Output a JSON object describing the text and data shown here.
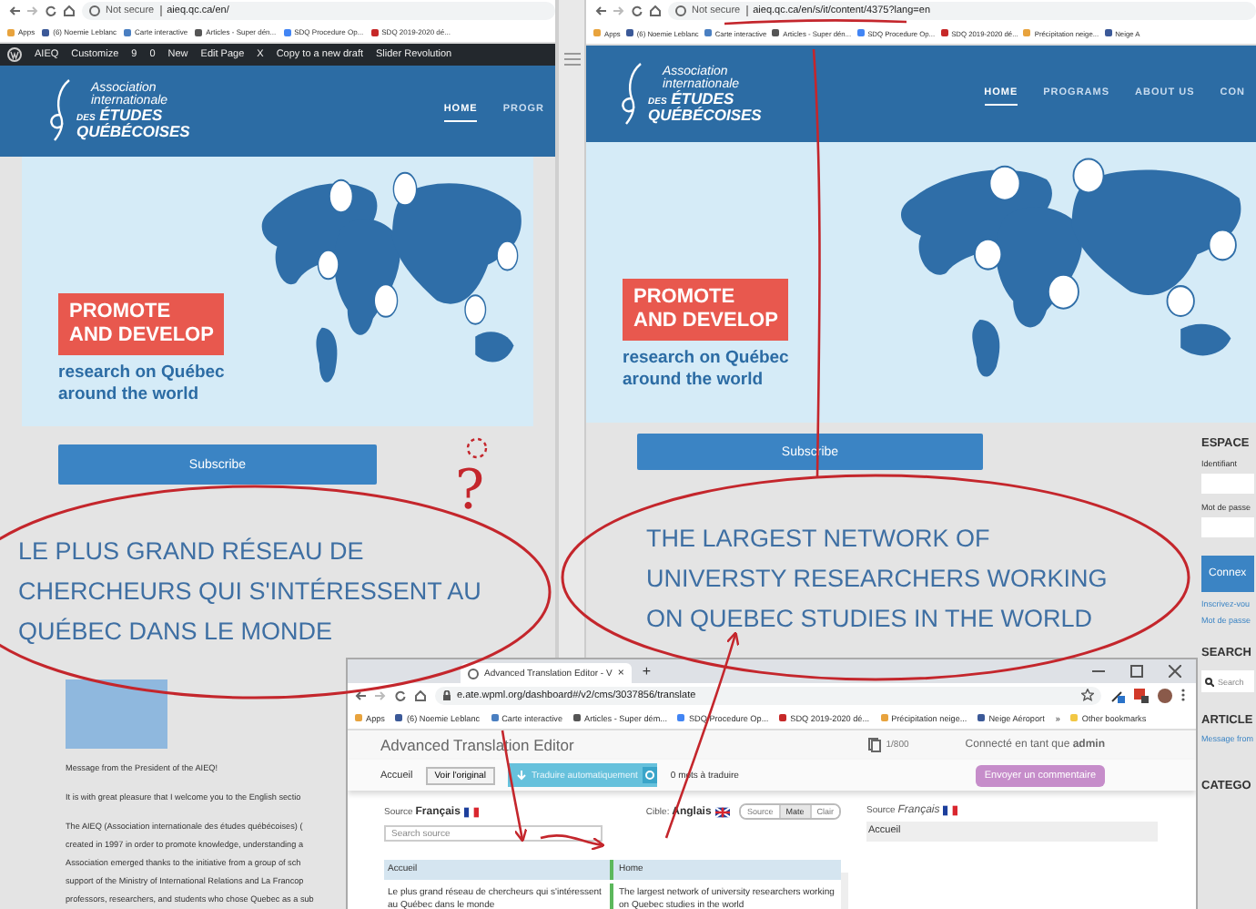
{
  "site_windows": [
    {
      "address": {
        "security": "Not secure",
        "url": "aieq.qc.ca/en/"
      },
      "bookmarks": [
        "Apps",
        "(6) Noemie Leblanc",
        "Carte interactive",
        "Articles - Super dén...",
        "SDQ Procedure Op...",
        "SDQ 2019-2020 dé..."
      ],
      "admin_bar": [
        "AIEQ",
        "Customize",
        "9",
        "0",
        "New",
        "Edit Page",
        "X",
        "Copy to a new draft",
        "Slider Revolution"
      ],
      "logo": {
        "line_1": "Association",
        "line_2": "internationale",
        "prefix": "DES",
        "line_3": "ÉTUDES",
        "line_4": "QUÉBÉCOISES"
      },
      "nav": [
        {
          "label": "HOME",
          "selected": true
        },
        {
          "label": "PROGR",
          "selected": false
        }
      ],
      "banner": {
        "headline": [
          "PROMOTE",
          "AND DEVELOP"
        ],
        "subline": [
          "research on Québec",
          "around the world"
        ]
      },
      "subscribe": "Subscribe",
      "heading_lines": [
        "LE PLUS GRAND RÉSEAU DE",
        "CHERCHEURS QUI S'INTÉRESSENT AU",
        "QUÉBEC DANS LE MONDE"
      ],
      "greeting": "Message from the President of the AIEQ!",
      "paragraphs": [
        [
          "It is with great pleasure that I welcome you to the English sectio"
        ],
        [
          "The AIEQ (Association internationale des études québécoises) (",
          "created in 1997 in order to promote knowledge, understanding a",
          "Association emerged thanks to the initiative from a group of sch",
          "support of the Ministry of International Relations and La Francop",
          "professors, researchers, and students who chose Quebec as a sub"
        ]
      ]
    },
    {
      "address": {
        "security": "Not secure",
        "url": "aieq.qc.ca/en/s/it/content/4375?lang=en"
      },
      "bookmarks": [
        "Apps",
        "(6) Noemie Leblanc",
        "Carte interactive",
        "Articles - Super dén...",
        "SDQ Procedure Op...",
        "SDQ 2019-2020 dé...",
        "Précipitation neige...",
        "Neige A"
      ],
      "logo": {
        "line_1": "Association",
        "line_2": "internationale",
        "prefix": "DES",
        "line_3": "ÉTUDES",
        "line_4": "QUÉBÉCOISES"
      },
      "nav": [
        {
          "label": "HOME",
          "selected": true
        },
        {
          "label": "PROGRAMS",
          "selected": false
        },
        {
          "label": "ABOUT US",
          "selected": false
        },
        {
          "label": "CON",
          "selected": false
        }
      ],
      "banner": {
        "headline": [
          "PROMOTE",
          "AND DEVELOP"
        ],
        "subline": [
          "research on Québec",
          "around the world"
        ]
      },
      "subscribe": "Subscribe",
      "heading_lines": [
        "THE LARGEST NETWORK OF",
        "UNIVERSTY RESEARCHERS WORKING",
        "ON QUEBEC STUDIES IN THE WORLD"
      ],
      "sidebar": {
        "title": "ESPACE",
        "fields": [
          "Identifiant",
          "Mot de passe"
        ],
        "login_button": "Connex",
        "links": [
          "Inscrivez-vou",
          "Mot de passe"
        ],
        "search_title": "SEARCH",
        "search_placeholder": "Search",
        "articles_title": "ARTICLE",
        "article_link": "Message from",
        "categories_title": "CATEGO"
      }
    }
  ],
  "editor_window": {
    "tab": "Advanced Translation Editor - V",
    "tab_close": "×",
    "new_tab": "+",
    "url": "e.ate.wpml.org/dashboard#/v2/cms/3037856/translate",
    "bookmarks": [
      "Apps",
      "(6) Noemie Leblanc",
      "Carte interactive",
      "Articles - Super dém...",
      "SDQ Procedure Op...",
      "SDQ 2019-2020 dé...",
      "Précipitation neige...",
      "Neige Aéroport"
    ],
    "more_bookmarks": "»",
    "other_bookmarks": "Other bookmarks",
    "title": "Advanced Translation Editor",
    "counter": "1/800",
    "login": "Connecté en tant que **admin**",
    "crumb": "Accueil",
    "view_original": "Voir l'original",
    "auto_translate": "Traduire automatiquement",
    "words_left": "0 mots à traduire",
    "feedback": "Envoyer un commentaire",
    "source_label": "Source",
    "source_lang": "Français",
    "target_label": "Cible:",
    "target_lang": "Anglais",
    "view_modes": [
      {
        "label": "Source",
        "selected": false
      },
      {
        "label": "Mate",
        "selected": true
      },
      {
        "label": "Clair",
        "selected": false
      }
    ],
    "search_placeholder": "Search source",
    "rows": [
      {
        "source": "Accueil",
        "target": "Home",
        "header": true
      },
      {
        "source": "Le plus grand réseau de chercheurs qui s'intéressent au Québec dans le monde",
        "target": "The largest network of university researchers working on Quebec studies in the world",
        "header": false
      }
    ],
    "panel": {
      "label": "Source",
      "lang": "Français",
      "text": "Accueil"
    }
  },
  "annotations": {
    "question_mark": "?"
  }
}
